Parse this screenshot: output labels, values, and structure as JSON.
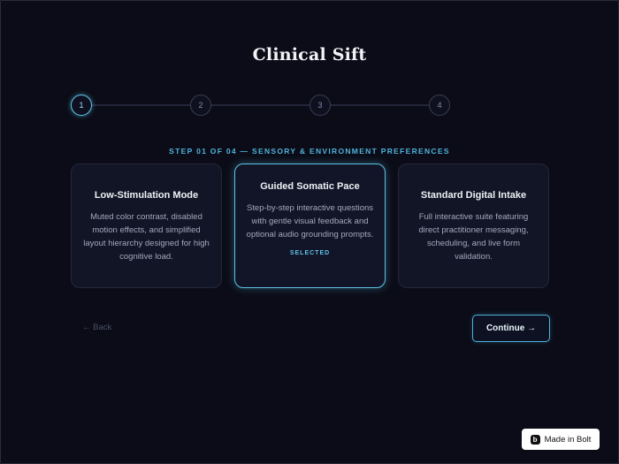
{
  "app": {
    "title": "Clinical Sift"
  },
  "stepper": {
    "steps": [
      "1",
      "2",
      "3",
      "4"
    ],
    "active_index": 0,
    "label": "STEP 01 OF 04 — SENSORY & ENVIRONMENT PREFERENCES"
  },
  "cards": [
    {
      "title": "Low-Stimulation Mode",
      "description": "Muted color contrast, disabled motion effects, and simplified layout hierarchy designed for high cognitive load.",
      "selected": false
    },
    {
      "title": "Guided Somatic Pace",
      "description": "Step-by-step interactive questions with gentle visual feedback and optional audio grounding prompts.",
      "selected": true,
      "badge": "SELECTED"
    },
    {
      "title": "Standard Digital Intake",
      "description": "Full interactive suite featuring direct practitioner messaging, scheduling, and live form validation.",
      "selected": false
    }
  ],
  "nav": {
    "back_label": "← Back",
    "continue_label": "Continue →"
  },
  "footer": {
    "bolt_label": "Made in Bolt",
    "bolt_icon": "b"
  },
  "colors": {
    "accent": "#5ec3e8",
    "background": "#0b0c17",
    "card": "#121526"
  }
}
